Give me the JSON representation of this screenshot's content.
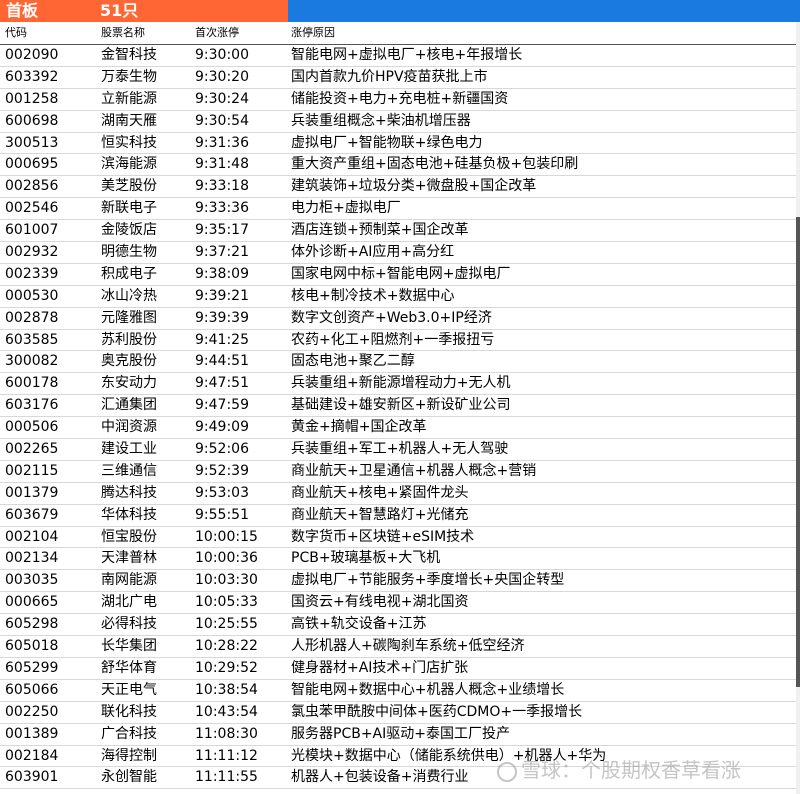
{
  "title": {
    "label": "首板",
    "count": "51只"
  },
  "colors": {
    "title_left_bg": "#ff6633",
    "title_right_bg": "#1a7ae0"
  },
  "headers": {
    "code": "代码",
    "name": "股票名称",
    "time": "首次涨停",
    "reason": "涨停原因"
  },
  "rows": [
    {
      "code": "002090",
      "name": "金智科技",
      "time": "9:30:00",
      "reason": "智能电网+虚拟电厂+核电+年报增长"
    },
    {
      "code": "603392",
      "name": "万泰生物",
      "time": "9:30:20",
      "reason": "国内首款九价HPV疫苗获批上市"
    },
    {
      "code": "001258",
      "name": "立新能源",
      "time": "9:30:24",
      "reason": "储能投资+电力+充电桩+新疆国资"
    },
    {
      "code": "600698",
      "name": "湖南天雁",
      "time": "9:30:54",
      "reason": "兵装重组概念+柴油机增压器"
    },
    {
      "code": "300513",
      "name": "恒实科技",
      "time": "9:31:36",
      "reason": "虚拟电厂+智能物联+绿色电力"
    },
    {
      "code": "000695",
      "name": "滨海能源",
      "time": "9:31:48",
      "reason": "重大资产重组+固态电池+硅基负极+包装印刷"
    },
    {
      "code": "002856",
      "name": "美芝股份",
      "time": "9:33:18",
      "reason": "建筑装饰+垃圾分类+微盘股+国企改革"
    },
    {
      "code": "002546",
      "name": "新联电子",
      "time": "9:33:36",
      "reason": "电力柜+虚拟电厂"
    },
    {
      "code": "601007",
      "name": "金陵饭店",
      "time": "9:35:17",
      "reason": "酒店连锁+预制菜+国企改革"
    },
    {
      "code": "002932",
      "name": "明德生物",
      "time": "9:37:21",
      "reason": "体外诊断+AI应用+高分红"
    },
    {
      "code": "002339",
      "name": "积成电子",
      "time": "9:38:09",
      "reason": "国家电网中标+智能电网+虚拟电厂"
    },
    {
      "code": "000530",
      "name": "冰山冷热",
      "time": "9:39:21",
      "reason": "核电+制冷技术+数据中心"
    },
    {
      "code": "002878",
      "name": "元隆雅图",
      "time": "9:39:39",
      "reason": "数字文创资产+Web3.0+IP经济"
    },
    {
      "code": "603585",
      "name": "苏利股份",
      "time": "9:41:25",
      "reason": "农药+化工+阻燃剂+一季报扭亏"
    },
    {
      "code": "300082",
      "name": "奥克股份",
      "time": "9:44:51",
      "reason": "固态电池+聚乙二醇"
    },
    {
      "code": "600178",
      "name": "东安动力",
      "time": "9:47:51",
      "reason": "兵装重组+新能源增程动力+无人机"
    },
    {
      "code": "603176",
      "name": "汇通集团",
      "time": "9:47:59",
      "reason": "基础建设+雄安新区+新设矿业公司"
    },
    {
      "code": "000506",
      "name": "中润资源",
      "time": "9:49:09",
      "reason": "黄金+摘帽+国企改革"
    },
    {
      "code": "002265",
      "name": "建设工业",
      "time": "9:52:06",
      "reason": "兵装重组+军工+机器人+无人驾驶"
    },
    {
      "code": "002115",
      "name": "三维通信",
      "time": "9:52:39",
      "reason": "商业航天+卫星通信+机器人概念+营销"
    },
    {
      "code": "001379",
      "name": "腾达科技",
      "time": "9:53:03",
      "reason": "商业航天+核电+紧固件龙头"
    },
    {
      "code": "603679",
      "name": "华体科技",
      "time": "9:55:51",
      "reason": "商业航天+智慧路灯+光储充"
    },
    {
      "code": "002104",
      "name": "恒宝股份",
      "time": "10:00:15",
      "reason": "数字货币+区块链+eSIM技术"
    },
    {
      "code": "002134",
      "name": "天津普林",
      "time": "10:00:36",
      "reason": "PCB+玻璃基板+大飞机"
    },
    {
      "code": "003035",
      "name": "南网能源",
      "time": "10:03:30",
      "reason": "虚拟电厂+节能服务+季度增长+央国企转型"
    },
    {
      "code": "000665",
      "name": "湖北广电",
      "time": "10:05:33",
      "reason": "国资云+有线电视+湖北国资"
    },
    {
      "code": "605298",
      "name": "必得科技",
      "time": "10:25:55",
      "reason": "高铁+轨交设备+江苏"
    },
    {
      "code": "605018",
      "name": "长华集团",
      "time": "10:28:22",
      "reason": "人形机器人+碳陶刹车系统+低空经济"
    },
    {
      "code": "605299",
      "name": "舒华体育",
      "time": "10:29:52",
      "reason": "健身器材+AI技术+门店扩张"
    },
    {
      "code": "605066",
      "name": "天正电气",
      "time": "10:38:54",
      "reason": "智能电网+数据中心+机器人概念+业绩增长"
    },
    {
      "code": "002250",
      "name": "联化科技",
      "time": "10:43:54",
      "reason": "氯虫苯甲酰胺中间体+医药CDMO+一季报增长"
    },
    {
      "code": "001389",
      "name": "广合科技",
      "time": "11:08:30",
      "reason": "服务器PCB+AI驱动+泰国工厂投产"
    },
    {
      "code": "002184",
      "name": "海得控制",
      "time": "11:11:12",
      "reason": "光模块+数据中心（储能系统供电）+机器人+华为"
    },
    {
      "code": "603901",
      "name": "永创智能",
      "time": "11:11:55",
      "reason": "机器人+包装设备+消费行业"
    }
  ],
  "watermark": {
    "text": "雪球：个股期权香草看涨",
    "icon": "snowball-logo-icon"
  }
}
